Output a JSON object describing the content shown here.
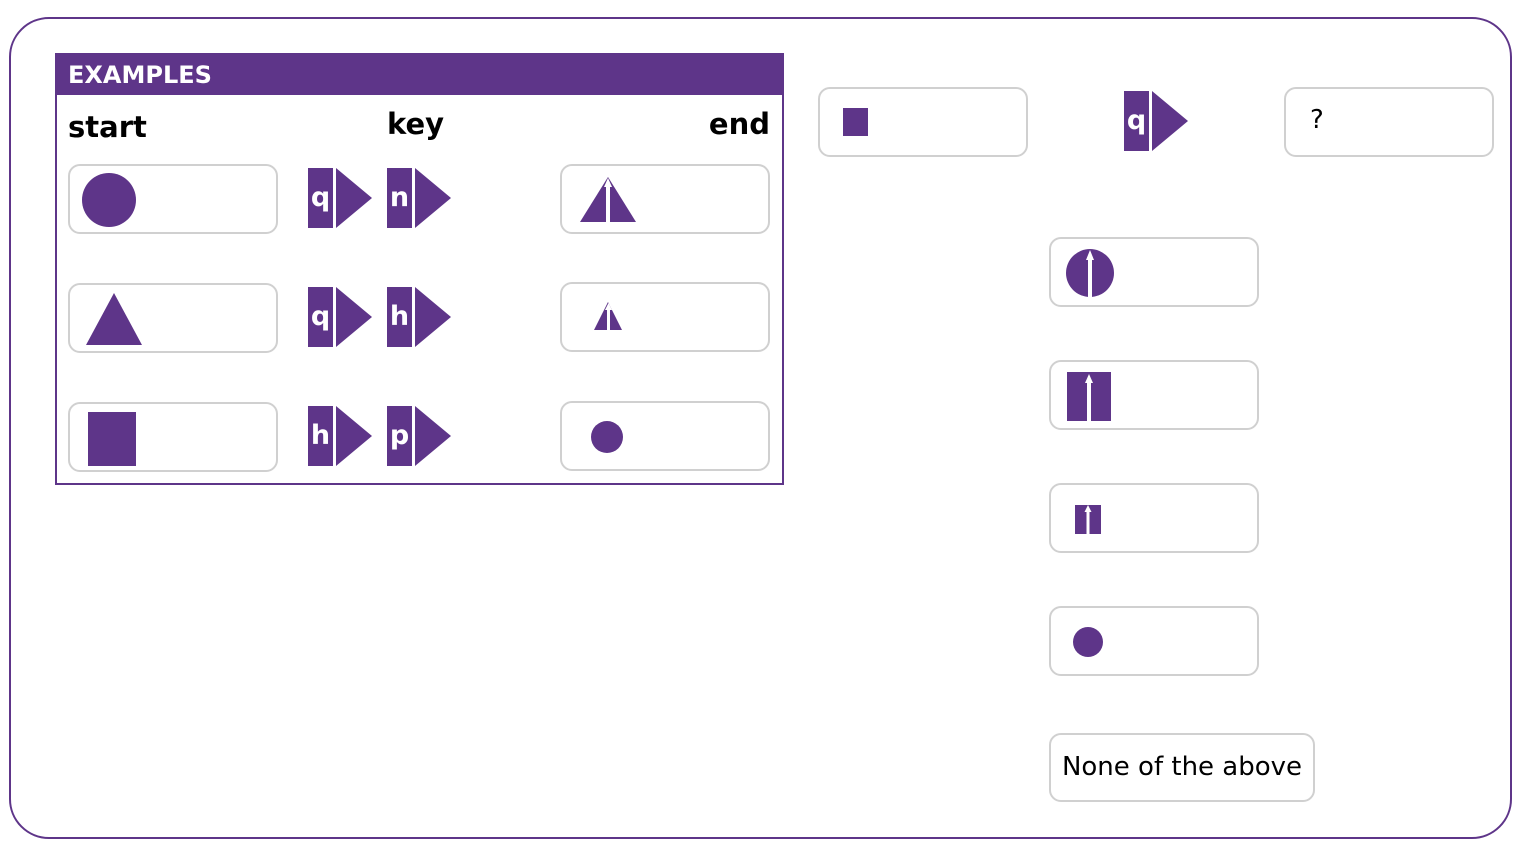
{
  "colors": {
    "accent": "#5e3589",
    "box_border": "#d0d0d0"
  },
  "examples": {
    "title": "EXAMPLES",
    "columns": {
      "start": "start",
      "key": "key",
      "end": "end"
    },
    "rows": [
      {
        "start_shape": "large-circle",
        "keys": [
          "q",
          "n"
        ],
        "end_shape": "large-triangle-with-arrow"
      },
      {
        "start_shape": "large-triangle",
        "keys": [
          "q",
          "h"
        ],
        "end_shape": "small-triangle-with-arrow"
      },
      {
        "start_shape": "large-square",
        "keys": [
          "h",
          "p"
        ],
        "end_shape": "small-circle"
      }
    ]
  },
  "question": {
    "start_shape": "small-square",
    "key": "q",
    "answer_placeholder": "?"
  },
  "options": [
    {
      "shape": "large-circle-with-arrow"
    },
    {
      "shape": "large-square-with-arrow"
    },
    {
      "shape": "small-square-with-arrow"
    },
    {
      "shape": "small-circle"
    },
    {
      "label": "None of the above"
    }
  ]
}
